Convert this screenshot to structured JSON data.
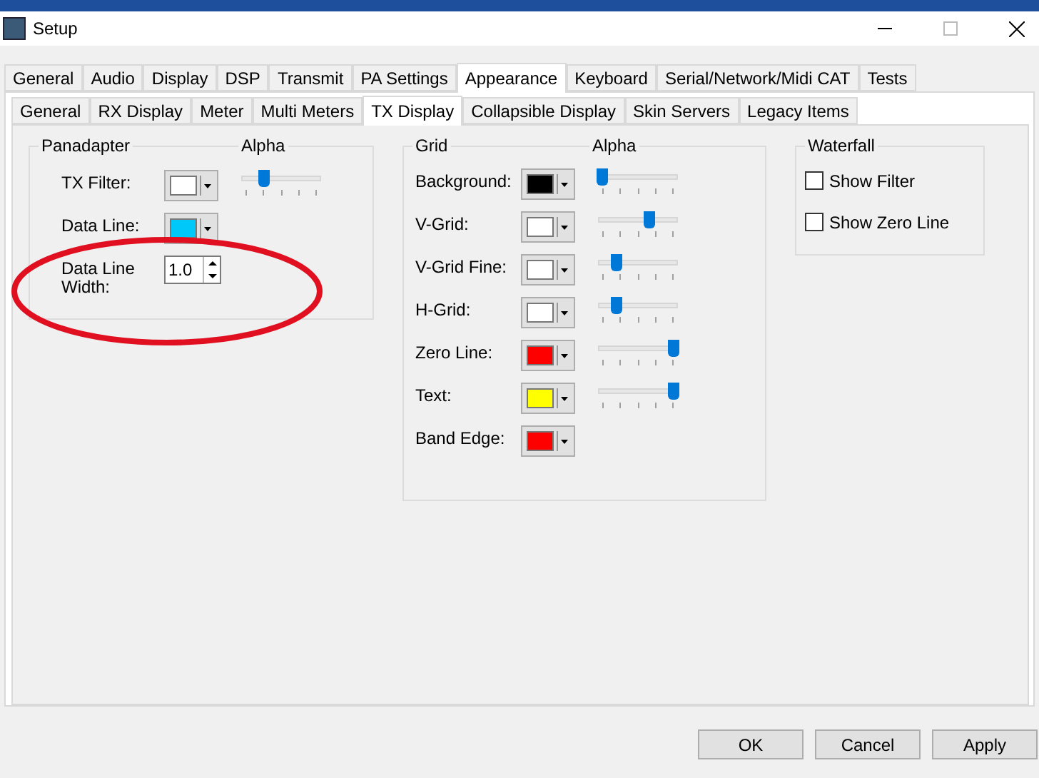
{
  "window": {
    "title": "Setup"
  },
  "tabs": [
    {
      "label": "General",
      "selected": false
    },
    {
      "label": "Audio",
      "selected": false
    },
    {
      "label": "Display",
      "selected": false
    },
    {
      "label": "DSP",
      "selected": false
    },
    {
      "label": "Transmit",
      "selected": false
    },
    {
      "label": "PA Settings",
      "selected": false
    },
    {
      "label": "Appearance",
      "selected": true
    },
    {
      "label": "Keyboard",
      "selected": false
    },
    {
      "label": "Serial/Network/Midi CAT",
      "selected": false
    },
    {
      "label": "Tests",
      "selected": false
    }
  ],
  "subtabs": [
    {
      "label": "General",
      "selected": false
    },
    {
      "label": "RX Display",
      "selected": false
    },
    {
      "label": "Meter",
      "selected": false
    },
    {
      "label": "Multi Meters",
      "selected": false
    },
    {
      "label": "TX Display",
      "selected": true
    },
    {
      "label": "Collapsible Display",
      "selected": false
    },
    {
      "label": "Skin Servers",
      "selected": false
    },
    {
      "label": "Legacy Items",
      "selected": false
    }
  ],
  "panadapter": {
    "title": "Panadapter",
    "alpha_label": "Alpha",
    "rows": [
      {
        "kind": "color",
        "label": "TX Filter:",
        "color": "#ffffff",
        "level": 0.25
      },
      {
        "kind": "color",
        "label": "Data Line:",
        "color": "#00c8f8"
      },
      {
        "kind": "number",
        "label": "Data Line Width:",
        "value": "1.0"
      }
    ]
  },
  "grid": {
    "title": "Grid",
    "alpha_label": "Alpha",
    "rows": [
      {
        "kind": "color",
        "label": "Background:",
        "color": "#000000",
        "level": 0
      },
      {
        "kind": "color",
        "label": "V-Grid:",
        "color": "#ffffff",
        "level": 0.65
      },
      {
        "kind": "color",
        "label": "V-Grid Fine:",
        "color": "#ffffff",
        "level": 0.2
      },
      {
        "kind": "color",
        "label": "H-Grid:",
        "color": "#ffffff",
        "level": 0.2
      },
      {
        "kind": "color",
        "label": "Zero Line:",
        "color": "#ff0000",
        "level": 1
      },
      {
        "kind": "color",
        "label": "Text:",
        "color": "#ffff00",
        "level": 1
      },
      {
        "kind": "color",
        "label": "Band Edge:",
        "color": "#ff0000"
      }
    ]
  },
  "waterfall": {
    "title": "Waterfall",
    "checkboxes": [
      {
        "label": "Show Filter",
        "checked": false
      },
      {
        "label": "Show Zero Line",
        "checked": false
      }
    ]
  },
  "buttons": [
    "OK",
    "Cancel",
    "Apply"
  ]
}
